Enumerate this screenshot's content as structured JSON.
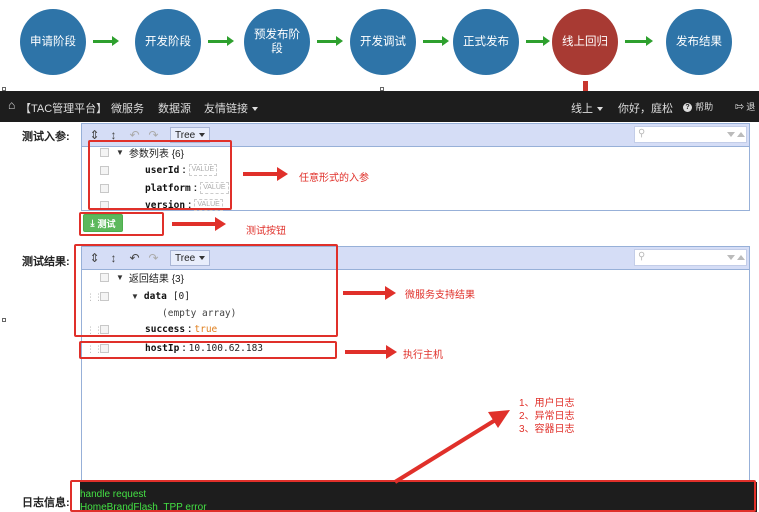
{
  "workflow": {
    "steps": [
      "申请阶段",
      "开发阶段",
      "预发布阶段",
      "开发调试",
      "正式发布",
      "线上回归",
      "发布结果"
    ]
  },
  "navbar": {
    "brand": "【TAC管理平台】",
    "links": [
      "微服务",
      "数据源",
      "友情链接"
    ],
    "env": "线上",
    "greeting": "你好，庭松",
    "help": "帮助",
    "logout": "退"
  },
  "input_section": {
    "label": "测试入参:",
    "view_mode": "Tree",
    "root": "参数列表 {6}",
    "fields": [
      {
        "key": "userId",
        "value_placeholder": "VALUE"
      },
      {
        "key": "platform",
        "value_placeholder": "VALUE"
      },
      {
        "key": "version",
        "value_placeholder": "VALUE"
      }
    ],
    "test_button": "测试"
  },
  "result_section": {
    "label": "测试结果:",
    "view_mode": "Tree",
    "root": "返回结果 {3}",
    "data_key": "data",
    "data_count": "[0]",
    "empty": "(empty array)",
    "success_key": "success",
    "success_value": "true",
    "host_key": "hostIp",
    "host_value": "10.100.62.183"
  },
  "log_section": {
    "label": "日志信息:",
    "lines": [
      "handle request",
      "HomeBrandFlash_TPP error"
    ]
  },
  "annotations": {
    "input_params": "任意形式的入参",
    "test_button": "测试按钮",
    "service_result": "微服务支持结果",
    "host": "执行主机",
    "logs": [
      "1、用户日志",
      "2、异常日志",
      "3、容器日志"
    ]
  },
  "colors": {
    "step": "#2e74a8",
    "step_current": "#a83a33",
    "workflow_arrow": "#2ea02e",
    "annotation": "#e0302a",
    "navbar": "#1d1d1d",
    "editor_toolbar": "#d5ddf6"
  }
}
